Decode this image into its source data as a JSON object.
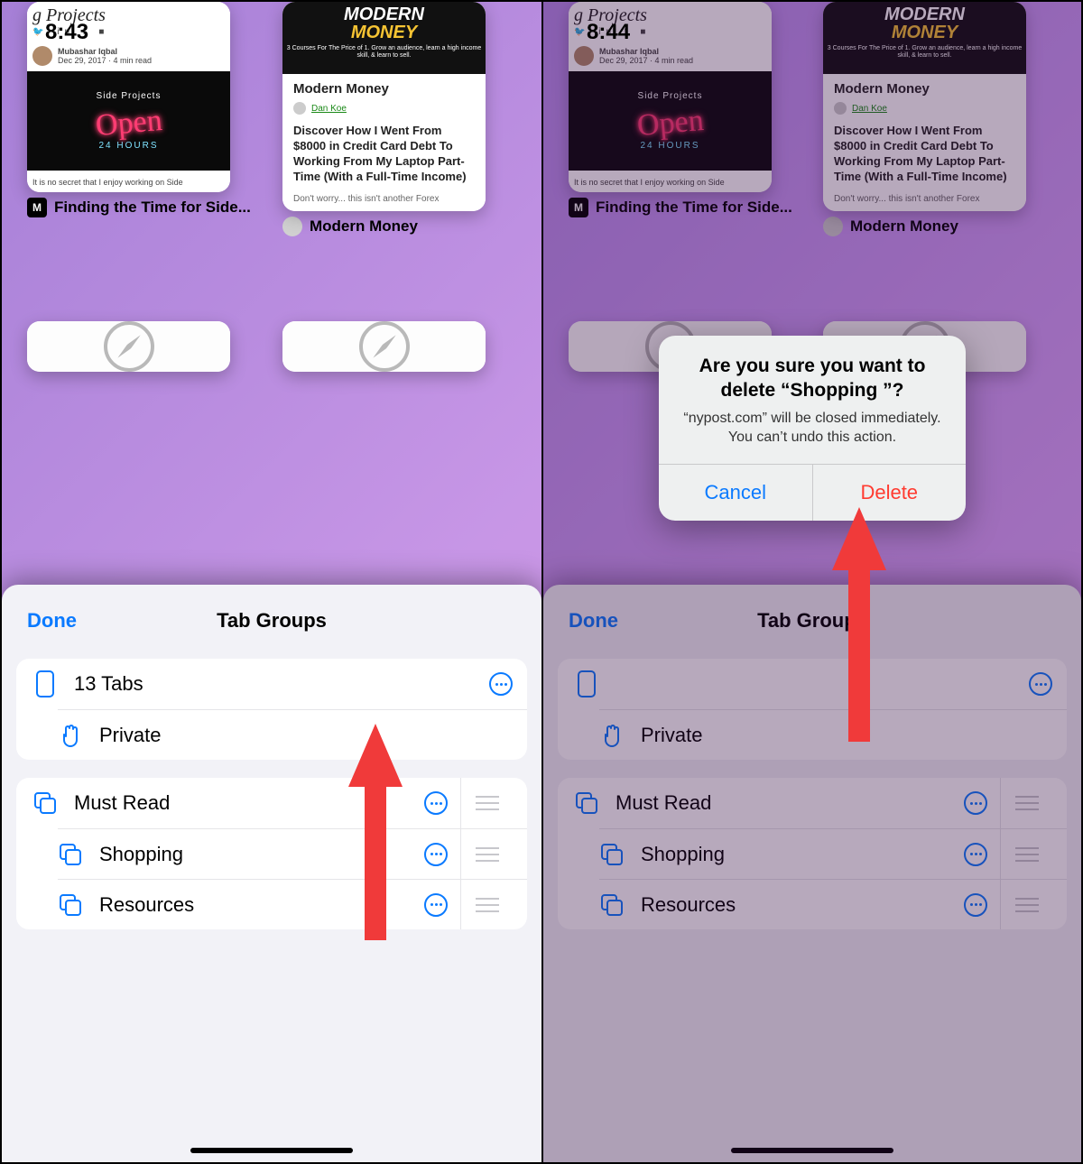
{
  "left": {
    "time": "8:43"
  },
  "right": {
    "time": "8:44"
  },
  "tabs": {
    "card1": {
      "caption": "Finding the Time for Side...",
      "header": "g Projects",
      "author": "Mubashar Iqbal",
      "meta": "Dec 29, 2017 · 4 min read",
      "neon_label": "Side Projects",
      "neon_main": "Open",
      "neon_sub": "24 HOURS",
      "footline": "It is no secret that I enjoy working on Side"
    },
    "card2": {
      "caption": "Modern Money",
      "top_line1": "MODERN",
      "top_line2": "MONEY",
      "top_sub": "3 Courses For The Price of 1. Grow an audience, learn a high income skill, & learn to sell.",
      "body_title": "Modern Money",
      "body_author": "Dan Koe",
      "headline": "Discover How I Went From $8000 in Credit Card Debt To Working From My Laptop Part-Time (With a Full-Time Income)",
      "small": "Don't worry... this isn't another Forex"
    }
  },
  "sheet": {
    "done": "Done",
    "title": "Tab Groups",
    "tabs_count_label": "13 Tabs",
    "private_label": "Private",
    "groups": [
      {
        "label": "Must Read"
      },
      {
        "label": "Shopping"
      },
      {
        "label": "Resources"
      }
    ]
  },
  "alert": {
    "title": "Are you sure you want to delete “Shopping ”?",
    "message": "“nypost.com” will be closed immediately. You can’t undo this action.",
    "cancel": "Cancel",
    "delete": "Delete"
  }
}
